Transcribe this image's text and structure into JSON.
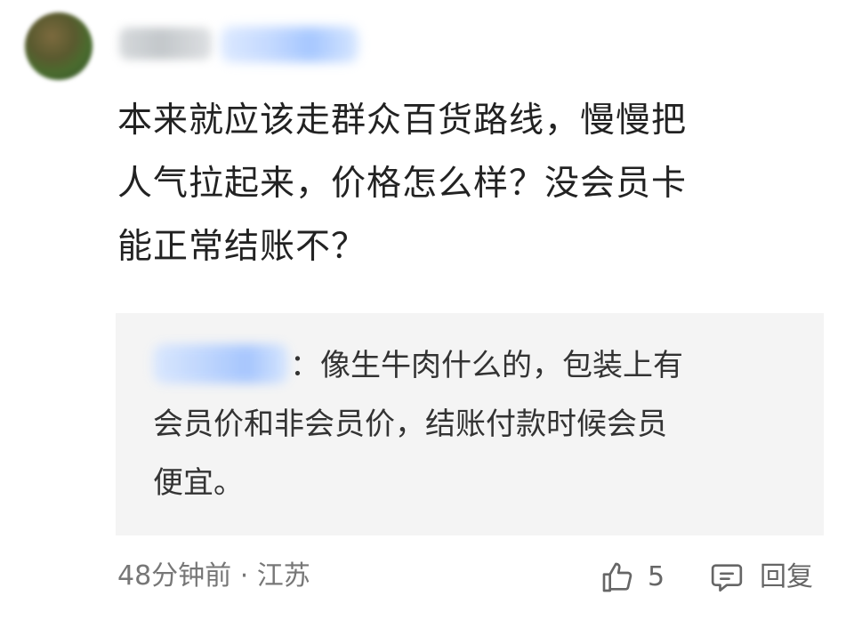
{
  "comment": {
    "text": "本来就应该走群众百货路线，慢慢把\n人气拉起来，价格怎么样？没会员卡\n能正常结账不？"
  },
  "reply": {
    "text": "：像生牛肉什么的，包装上有\n会员价和非会员价，结账付款时候会员\n便宜。"
  },
  "footer": {
    "meta": "48分钟前 · 江苏",
    "like_count": "5",
    "reply_label": "回复"
  },
  "icons": {
    "like": "thumbs-up-icon",
    "reply": "comment-bubble-icon"
  },
  "colors": {
    "text_primary": "#222222",
    "text_secondary": "#777777",
    "reply_background": "#f4f4f4",
    "blurred_badge": "#bfd6ff"
  }
}
